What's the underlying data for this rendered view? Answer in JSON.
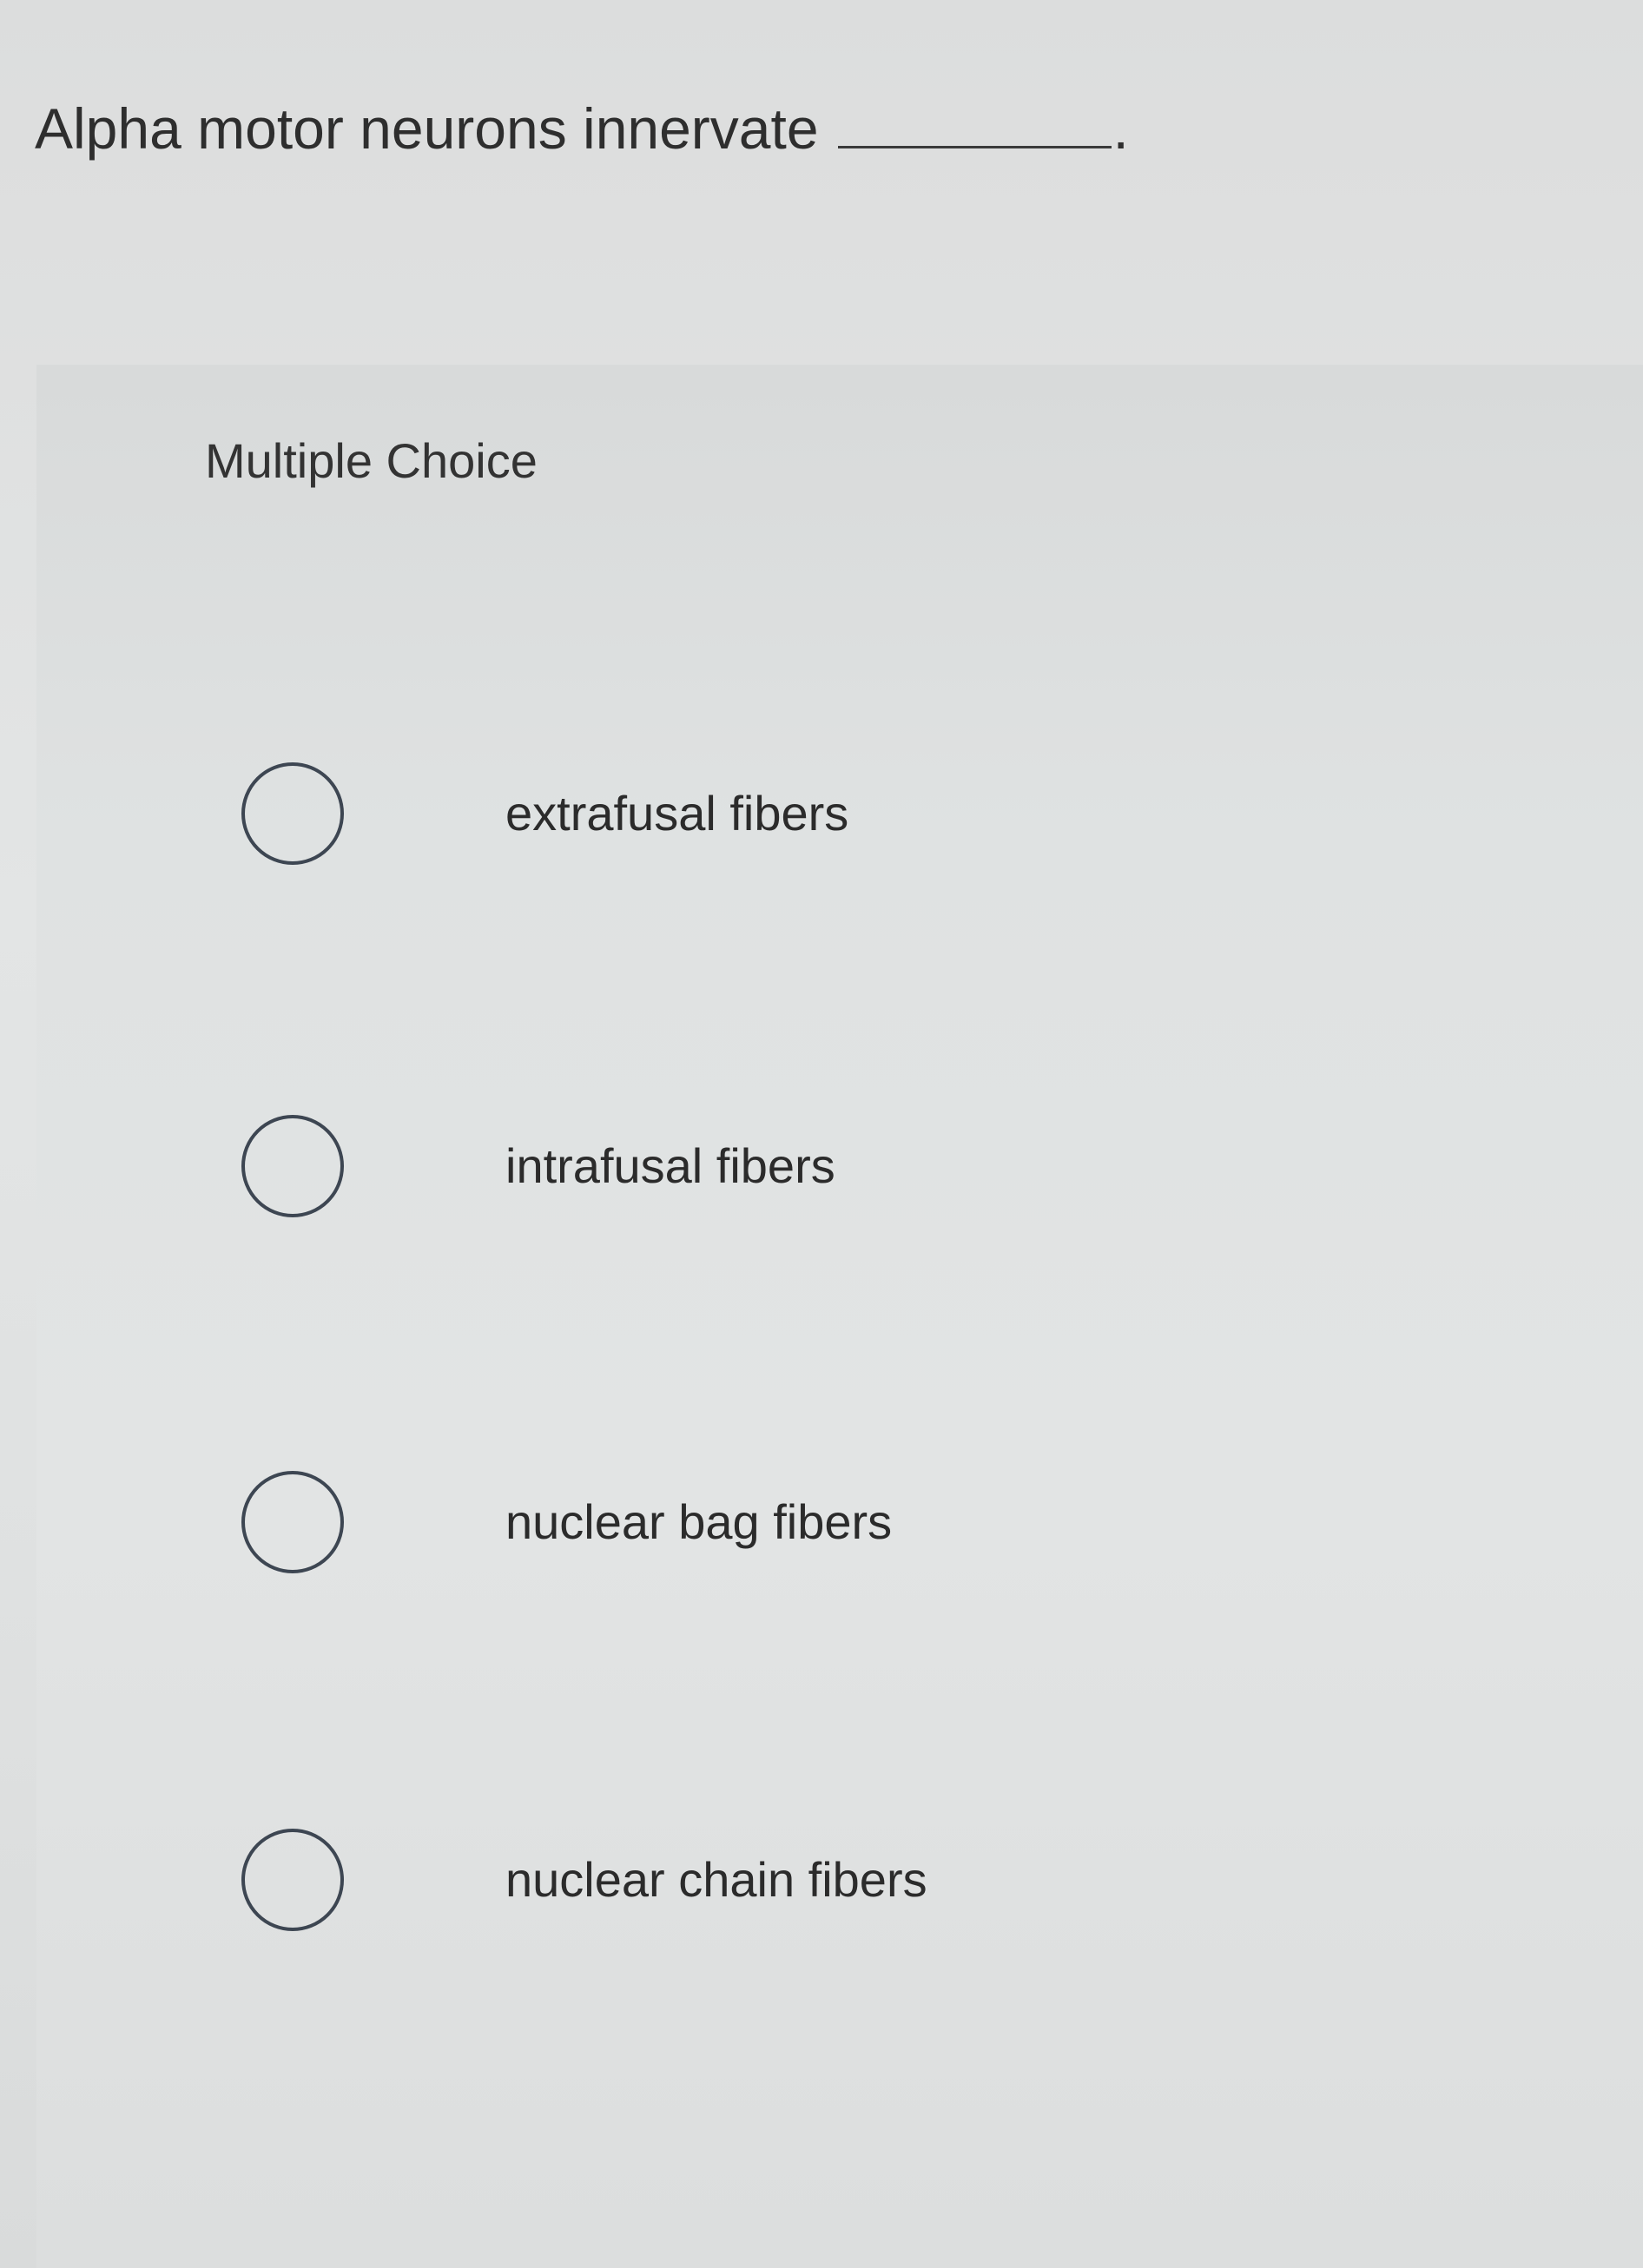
{
  "question": {
    "text": "Alpha motor neurons innervate",
    "terminator": "."
  },
  "panel": {
    "title": "Multiple Choice"
  },
  "options": [
    {
      "label": "extrafusal fibers",
      "selected": false
    },
    {
      "label": "intrafusal fibers",
      "selected": false
    },
    {
      "label": "nuclear bag fibers",
      "selected": false
    },
    {
      "label": "nuclear chain fibers",
      "selected": false
    }
  ]
}
